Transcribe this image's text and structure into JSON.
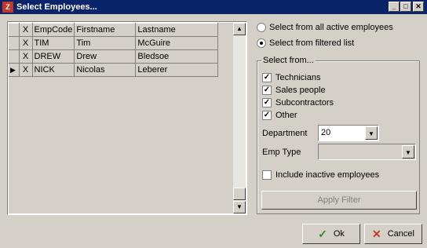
{
  "window": {
    "title": "Select Employees...",
    "icon_text": "Z",
    "min_glyph": "_",
    "max_glyph": "□",
    "close_glyph": "✕"
  },
  "grid": {
    "columns": [
      "",
      "X",
      "EmpCode",
      "Firstname",
      "Lastname"
    ],
    "rows": [
      {
        "marker": "",
        "x": "X",
        "empcode": "TIM",
        "firstname": "Tim",
        "lastname": "McGuire"
      },
      {
        "marker": "",
        "x": "X",
        "empcode": "DREW",
        "firstname": "Drew",
        "lastname": "Bledsoe"
      },
      {
        "marker": "▶",
        "x": "X",
        "empcode": "NICK",
        "firstname": "Nicolas",
        "lastname": "Leberer"
      }
    ],
    "scroll_up": "▲",
    "scroll_down": "▼"
  },
  "options": {
    "all_active_label": "Select from all active employees",
    "filtered_label": "Select from filtered list",
    "selected": "filtered"
  },
  "filter": {
    "group_label": "Select from...",
    "technicians_label": "Technicians",
    "sales_label": "Sales people",
    "subcontractors_label": "Subcontractors",
    "other_label": "Other",
    "department_label": "Department",
    "department_value": "20",
    "emp_type_label": "Emp Type",
    "emp_type_value": "",
    "include_inactive_label": "Include inactive employees",
    "apply_label": "Apply Filter",
    "check_glyph": "✓",
    "dropdown_glyph": "▼"
  },
  "buttons": {
    "ok_label": "Ok",
    "ok_icon": "✓",
    "cancel_label": "Cancel",
    "cancel_icon": "✕"
  },
  "colors": {
    "titlebar": "#0a246a",
    "face": "#d4d0c8",
    "ok_icon": "#2a8a2a",
    "cancel_icon": "#c0392b"
  }
}
